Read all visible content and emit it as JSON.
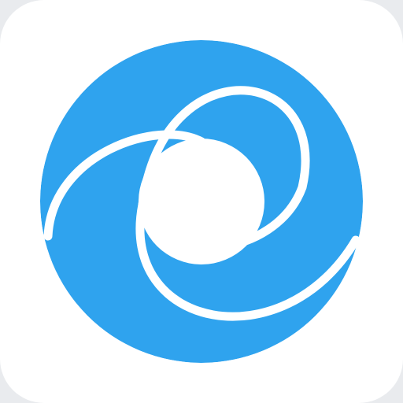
{
  "app_icon": {
    "icon": "blue-swirl-ring-logo",
    "colors": {
      "background": "#ffffff",
      "brand": "#2fa3ee",
      "swirl_gap": "#ffffff"
    }
  }
}
